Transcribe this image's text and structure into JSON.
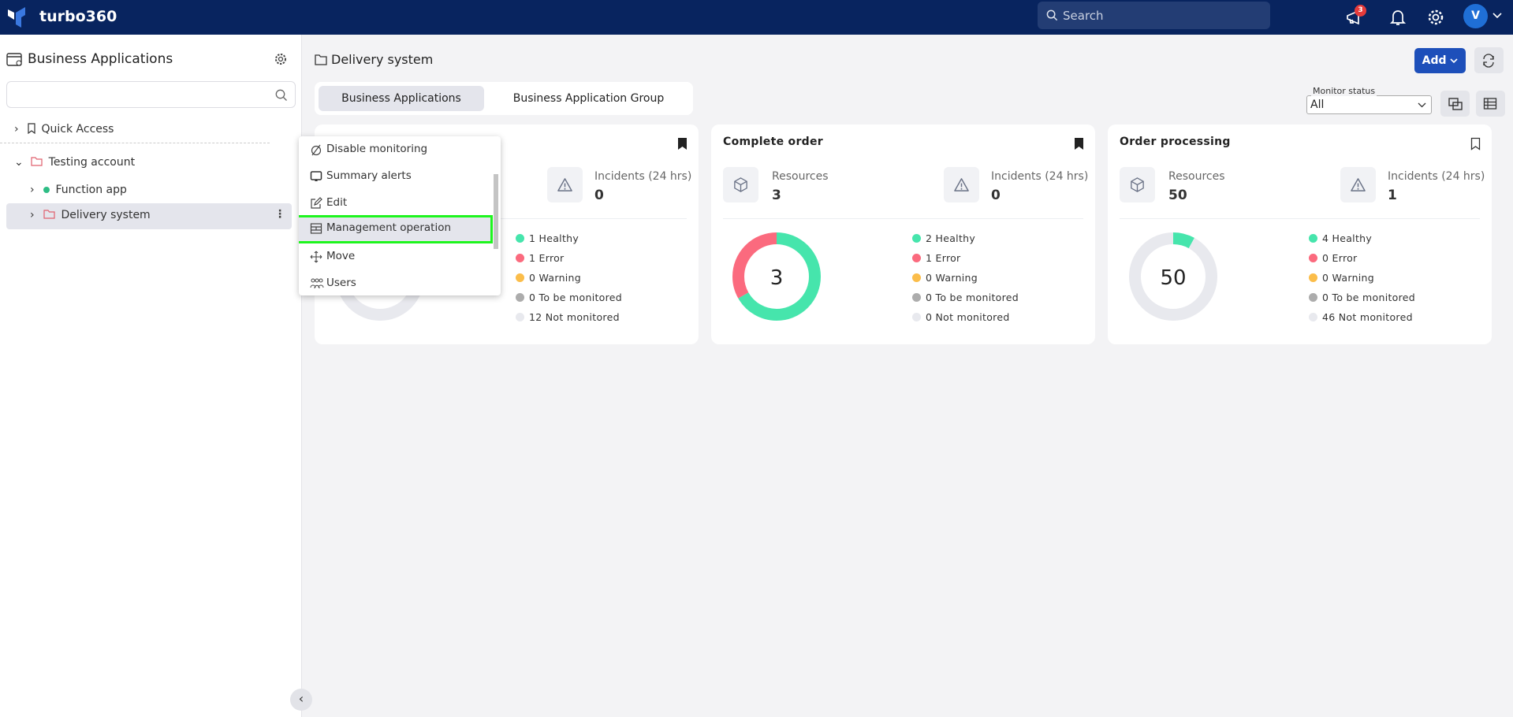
{
  "header": {
    "brand": "turbo360",
    "search_placeholder": "Search",
    "notification_count": "3",
    "avatar_initial": "V"
  },
  "sidebar": {
    "title": "Business Applications",
    "search_value": "",
    "items": [
      {
        "label": "Quick Access",
        "icon": "bookmark-icon"
      },
      {
        "label": "Testing account",
        "icon": "folder-icon",
        "expanded": true
      },
      {
        "label": "Function app",
        "icon": "status-dot",
        "status_color": "#2ebd85"
      },
      {
        "label": "Delivery system",
        "icon": "folder-icon",
        "selected": true
      }
    ]
  },
  "main": {
    "title": "Delivery system",
    "tabs": [
      {
        "label": "Business Applications",
        "active": true
      },
      {
        "label": "Business Application Group",
        "active": false
      }
    ],
    "add_label": "Add",
    "monitor_status": {
      "label": "Monitor status",
      "value": "All"
    }
  },
  "context_menu": {
    "items": [
      {
        "label": "Disable monitoring"
      },
      {
        "label": "Summary alerts"
      },
      {
        "label": "Edit"
      },
      {
        "label": "Management operation",
        "highlighted": true
      },
      {
        "label": "Move"
      },
      {
        "label": "Users"
      }
    ]
  },
  "colors": {
    "healthy": "#46e5ac",
    "error": "#fb6a7e",
    "warning": "#fbbd4a",
    "to_be_monitored": "#acacac",
    "not_monitored": "#e8e9ee",
    "accent": "#1d4fba",
    "header": "#08245f"
  },
  "cards": [
    {
      "title": "",
      "bookmarked": true,
      "resources_label": "Resources",
      "resources": "",
      "incidents_label": "Incidents (24 hrs)",
      "incidents": "0",
      "center": "",
      "legend": [
        {
          "key": "healthy",
          "count": 1,
          "text": "1 Healthy"
        },
        {
          "key": "error",
          "count": 1,
          "text": "1 Error"
        },
        {
          "key": "warning",
          "count": 0,
          "text": "0 Warning"
        },
        {
          "key": "to_be_monitored",
          "count": 0,
          "text": "0 To be monitored"
        },
        {
          "key": "not_monitored",
          "count": 12,
          "text": "12 Not monitored"
        }
      ]
    },
    {
      "title": "Complete order",
      "bookmarked": true,
      "resources_label": "Resources",
      "resources": "3",
      "incidents_label": "Incidents (24 hrs)",
      "incidents": "0",
      "center": "3",
      "legend": [
        {
          "key": "healthy",
          "count": 2,
          "text": "2 Healthy"
        },
        {
          "key": "error",
          "count": 1,
          "text": "1 Error"
        },
        {
          "key": "warning",
          "count": 0,
          "text": "0 Warning"
        },
        {
          "key": "to_be_monitored",
          "count": 0,
          "text": "0 To be monitored"
        },
        {
          "key": "not_monitored",
          "count": 0,
          "text": "0 Not monitored"
        }
      ]
    },
    {
      "title": "Order processing",
      "bookmarked": false,
      "resources_label": "Resources",
      "resources": "50",
      "incidents_label": "Incidents (24 hrs)",
      "incidents": "1",
      "center": "50",
      "legend": [
        {
          "key": "healthy",
          "count": 4,
          "text": "4 Healthy"
        },
        {
          "key": "error",
          "count": 0,
          "text": "0 Error"
        },
        {
          "key": "warning",
          "count": 0,
          "text": "0 Warning"
        },
        {
          "key": "to_be_monitored",
          "count": 0,
          "text": "0 To be monitored"
        },
        {
          "key": "not_monitored",
          "count": 46,
          "text": "46 Not monitored"
        }
      ]
    }
  ]
}
